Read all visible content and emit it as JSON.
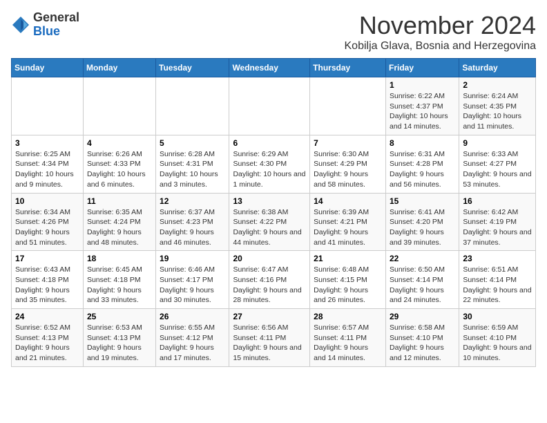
{
  "logo": {
    "general": "General",
    "blue": "Blue"
  },
  "header": {
    "month": "November 2024",
    "location": "Kobilja Glava, Bosnia and Herzegovina"
  },
  "days_of_week": [
    "Sunday",
    "Monday",
    "Tuesday",
    "Wednesday",
    "Thursday",
    "Friday",
    "Saturday"
  ],
  "weeks": [
    [
      {
        "day": "",
        "info": ""
      },
      {
        "day": "",
        "info": ""
      },
      {
        "day": "",
        "info": ""
      },
      {
        "day": "",
        "info": ""
      },
      {
        "day": "",
        "info": ""
      },
      {
        "day": "1",
        "info": "Sunrise: 6:22 AM\nSunset: 4:37 PM\nDaylight: 10 hours and 14 minutes."
      },
      {
        "day": "2",
        "info": "Sunrise: 6:24 AM\nSunset: 4:35 PM\nDaylight: 10 hours and 11 minutes."
      }
    ],
    [
      {
        "day": "3",
        "info": "Sunrise: 6:25 AM\nSunset: 4:34 PM\nDaylight: 10 hours and 9 minutes."
      },
      {
        "day": "4",
        "info": "Sunrise: 6:26 AM\nSunset: 4:33 PM\nDaylight: 10 hours and 6 minutes."
      },
      {
        "day": "5",
        "info": "Sunrise: 6:28 AM\nSunset: 4:31 PM\nDaylight: 10 hours and 3 minutes."
      },
      {
        "day": "6",
        "info": "Sunrise: 6:29 AM\nSunset: 4:30 PM\nDaylight: 10 hours and 1 minute."
      },
      {
        "day": "7",
        "info": "Sunrise: 6:30 AM\nSunset: 4:29 PM\nDaylight: 9 hours and 58 minutes."
      },
      {
        "day": "8",
        "info": "Sunrise: 6:31 AM\nSunset: 4:28 PM\nDaylight: 9 hours and 56 minutes."
      },
      {
        "day": "9",
        "info": "Sunrise: 6:33 AM\nSunset: 4:27 PM\nDaylight: 9 hours and 53 minutes."
      }
    ],
    [
      {
        "day": "10",
        "info": "Sunrise: 6:34 AM\nSunset: 4:26 PM\nDaylight: 9 hours and 51 minutes."
      },
      {
        "day": "11",
        "info": "Sunrise: 6:35 AM\nSunset: 4:24 PM\nDaylight: 9 hours and 48 minutes."
      },
      {
        "day": "12",
        "info": "Sunrise: 6:37 AM\nSunset: 4:23 PM\nDaylight: 9 hours and 46 minutes."
      },
      {
        "day": "13",
        "info": "Sunrise: 6:38 AM\nSunset: 4:22 PM\nDaylight: 9 hours and 44 minutes."
      },
      {
        "day": "14",
        "info": "Sunrise: 6:39 AM\nSunset: 4:21 PM\nDaylight: 9 hours and 41 minutes."
      },
      {
        "day": "15",
        "info": "Sunrise: 6:41 AM\nSunset: 4:20 PM\nDaylight: 9 hours and 39 minutes."
      },
      {
        "day": "16",
        "info": "Sunrise: 6:42 AM\nSunset: 4:19 PM\nDaylight: 9 hours and 37 minutes."
      }
    ],
    [
      {
        "day": "17",
        "info": "Sunrise: 6:43 AM\nSunset: 4:18 PM\nDaylight: 9 hours and 35 minutes."
      },
      {
        "day": "18",
        "info": "Sunrise: 6:45 AM\nSunset: 4:18 PM\nDaylight: 9 hours and 33 minutes."
      },
      {
        "day": "19",
        "info": "Sunrise: 6:46 AM\nSunset: 4:17 PM\nDaylight: 9 hours and 30 minutes."
      },
      {
        "day": "20",
        "info": "Sunrise: 6:47 AM\nSunset: 4:16 PM\nDaylight: 9 hours and 28 minutes."
      },
      {
        "day": "21",
        "info": "Sunrise: 6:48 AM\nSunset: 4:15 PM\nDaylight: 9 hours and 26 minutes."
      },
      {
        "day": "22",
        "info": "Sunrise: 6:50 AM\nSunset: 4:14 PM\nDaylight: 9 hours and 24 minutes."
      },
      {
        "day": "23",
        "info": "Sunrise: 6:51 AM\nSunset: 4:14 PM\nDaylight: 9 hours and 22 minutes."
      }
    ],
    [
      {
        "day": "24",
        "info": "Sunrise: 6:52 AM\nSunset: 4:13 PM\nDaylight: 9 hours and 21 minutes."
      },
      {
        "day": "25",
        "info": "Sunrise: 6:53 AM\nSunset: 4:13 PM\nDaylight: 9 hours and 19 minutes."
      },
      {
        "day": "26",
        "info": "Sunrise: 6:55 AM\nSunset: 4:12 PM\nDaylight: 9 hours and 17 minutes."
      },
      {
        "day": "27",
        "info": "Sunrise: 6:56 AM\nSunset: 4:11 PM\nDaylight: 9 hours and 15 minutes."
      },
      {
        "day": "28",
        "info": "Sunrise: 6:57 AM\nSunset: 4:11 PM\nDaylight: 9 hours and 14 minutes."
      },
      {
        "day": "29",
        "info": "Sunrise: 6:58 AM\nSunset: 4:10 PM\nDaylight: 9 hours and 12 minutes."
      },
      {
        "day": "30",
        "info": "Sunrise: 6:59 AM\nSunset: 4:10 PM\nDaylight: 9 hours and 10 minutes."
      }
    ]
  ]
}
